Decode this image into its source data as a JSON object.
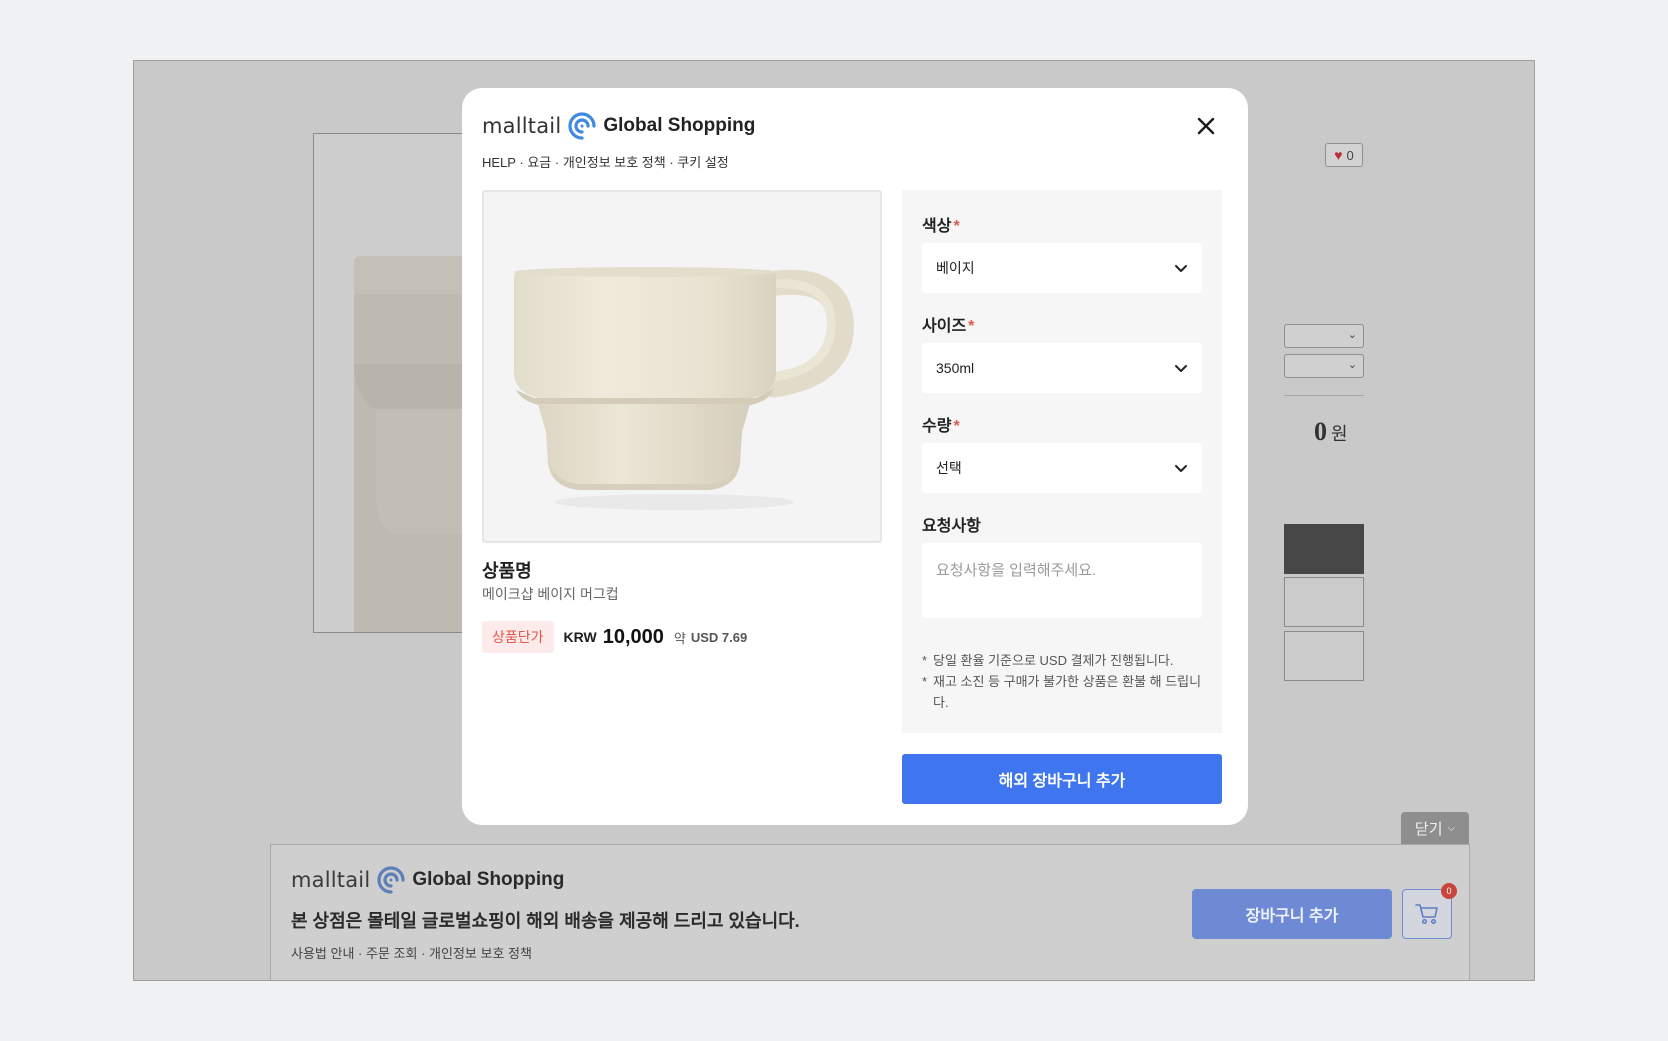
{
  "background_page": {
    "wish_count": "0",
    "total_amount": "0",
    "total_unit": "원"
  },
  "modal": {
    "brand": {
      "wordmark": "malltail",
      "tagline": "Global Shopping",
      "icon": "malltail-swirl-logo-icon"
    },
    "close_icon": "close-icon",
    "links": [
      "HELP",
      "요금",
      "개인정보 보호 정책",
      "쿠키 설정"
    ],
    "product": {
      "name_label": "상품명",
      "name": "메이크샵 베이지 머그컵",
      "price_badge": "상품단가",
      "currency": "KRW",
      "price": "10,000",
      "approx_label": "약",
      "usd_price": "USD 7.69"
    },
    "options": {
      "color": {
        "label": "색상",
        "required": "*",
        "value": "베이지"
      },
      "size": {
        "label": "사이즈",
        "required": "*",
        "value": "350ml"
      },
      "quantity": {
        "label": "수량",
        "required": "*",
        "value": "선택"
      },
      "request": {
        "label": "요청사항",
        "placeholder": "요청사항을 입력해주세요."
      }
    },
    "notes": [
      "당일 환율 기준으로 USD 결제가 진행됩니다.",
      "재고 소진 등 구매가 불가한 상품은 환불 해 드립니다."
    ],
    "add_to_cart": "해외 장바구니 추가"
  },
  "bottom_bar": {
    "close_tab": "닫기",
    "brand": {
      "wordmark": "malltail",
      "tagline": "Global Shopping"
    },
    "headline": "본 상점은 몰테일 글로벌쇼핑이 해외 배송을 제공해 드리고 있습니다.",
    "links": [
      "사용법 안내",
      "주문 조회",
      "개인정보 보호 정책"
    ],
    "cart_button": "장바구니 추가",
    "cart_count": "0"
  },
  "colors": {
    "accent": "#3f75ee",
    "required": "#e2574c",
    "overlay": "#c9c9c9"
  }
}
